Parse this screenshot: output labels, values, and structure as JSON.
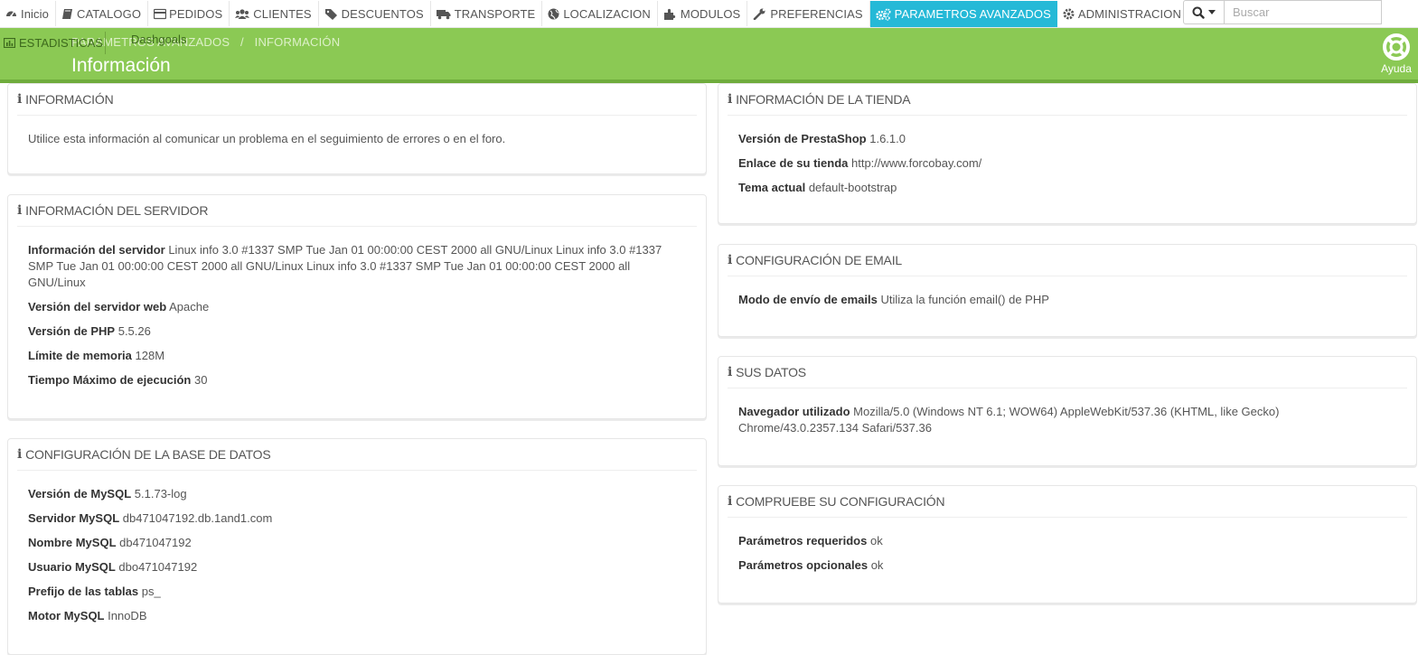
{
  "nav": {
    "items": [
      {
        "label": "Inicio",
        "icon": "dashboard-icon"
      },
      {
        "label": "CATALOGO",
        "icon": "book-icon"
      },
      {
        "label": "PEDIDOS",
        "icon": "credit-card-icon"
      },
      {
        "label": "CLIENTES",
        "icon": "users-icon"
      },
      {
        "label": "DESCUENTOS",
        "icon": "tag-icon"
      },
      {
        "label": "TRANSPORTE",
        "icon": "truck-icon"
      },
      {
        "label": "LOCALIZACION",
        "icon": "globe-icon"
      },
      {
        "label": "MODULOS",
        "icon": "puzzle-icon"
      },
      {
        "label": "PREFERENCIAS",
        "icon": "wrench-icon"
      },
      {
        "label": "PARAMETROS AVANZADOS",
        "icon": "cogs-icon",
        "active": true
      },
      {
        "label": "ADMINISTRACION",
        "icon": "cog-icon"
      }
    ],
    "search_placeholder": "Buscar"
  },
  "header": {
    "stats_tab": "ESTADISTICAS",
    "dashgoals": "Dashgoals",
    "breadcrumb_parent": "PARAMETROS AVANZADOS",
    "breadcrumb_current": "INFORMACIÓN",
    "title": "Información",
    "help_label": "Ayuda"
  },
  "colors": {
    "accent": "#25b9d7",
    "header_green": "#8bc954"
  },
  "panels": {
    "info": {
      "title": "INFORMACIÓN",
      "text": "Utilice esta información al comunicar un problema en el seguimiento de errores o en el foro."
    },
    "server": {
      "title": "INFORMACIÓN DEL SERVIDOR",
      "rows": [
        {
          "label": "Información del servidor",
          "value": "Linux info 3.0 #1337 SMP Tue Jan 01 00:00:00 CEST 2000 all GNU/Linux Linux info 3.0 #1337 SMP Tue Jan 01 00:00:00 CEST 2000 all GNU/Linux Linux info 3.0 #1337 SMP Tue Jan 01 00:00:00 CEST 2000 all GNU/Linux"
        },
        {
          "label": "Versión del servidor web",
          "value": "Apache"
        },
        {
          "label": "Versión de PHP",
          "value": "5.5.26"
        },
        {
          "label": "Límite de memoria",
          "value": "128M"
        },
        {
          "label": "Tiempo Máximo de ejecución",
          "value": "30"
        }
      ]
    },
    "db": {
      "title": "CONFIGURACIÓN DE LA BASE DE DATOS",
      "rows": [
        {
          "label": "Versión de MySQL",
          "value": "5.1.73-log"
        },
        {
          "label": "Servidor MySQL",
          "value": "db471047192.db.1and1.com"
        },
        {
          "label": "Nombre MySQL",
          "value": "db471047192"
        },
        {
          "label": "Usuario MySQL",
          "value": "dbo471047192"
        },
        {
          "label": "Prefijo de las tablas",
          "value": "ps_"
        },
        {
          "label": "Motor MySQL",
          "value": "InnoDB"
        }
      ]
    },
    "shop": {
      "title": "INFORMACIÓN DE LA TIENDA",
      "rows": [
        {
          "label": "Versión de PrestaShop",
          "value": "1.6.1.0"
        },
        {
          "label": "Enlace de su tienda",
          "value": "http://www.forcobay.com/"
        },
        {
          "label": "Tema actual",
          "value": "default-bootstrap"
        }
      ]
    },
    "email": {
      "title": "CONFIGURACIÓN DE EMAIL",
      "rows": [
        {
          "label": "Modo de envío de emails",
          "value": "Utiliza la función email() de PHP"
        }
      ]
    },
    "data": {
      "title": "SUS DATOS",
      "rows": [
        {
          "label": "Navegador utilizado",
          "value": "Mozilla/5.0 (Windows NT 6.1; WOW64) AppleWebKit/537.36 (KHTML, like Gecko) Chrome/43.0.2357.134 Safari/537.36"
        }
      ]
    },
    "check": {
      "title": "COMPRUEBE SU CONFIGURACIÓN",
      "rows": [
        {
          "label": "Parámetros requeridos",
          "value": "ok"
        },
        {
          "label": "Parámetros opcionales",
          "value": "ok"
        }
      ]
    }
  }
}
